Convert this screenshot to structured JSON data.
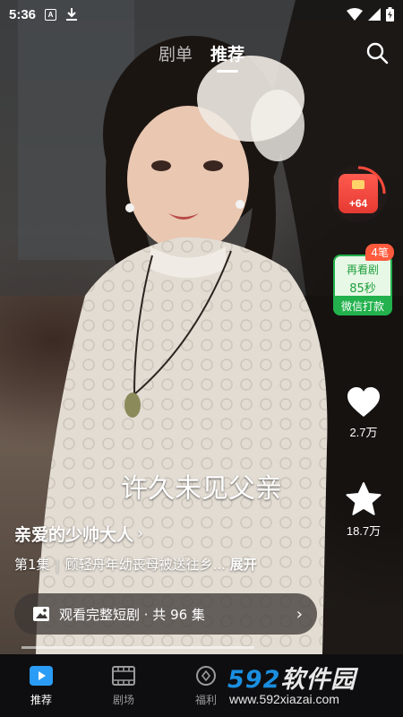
{
  "status_bar": {
    "time": "5:36",
    "app_icon_letter": "A"
  },
  "top_tabs": [
    {
      "label": "剧单",
      "active": false
    },
    {
      "label": "推荐",
      "active": true
    }
  ],
  "actions": {
    "redpacket_amount": "+64",
    "wechat_badge": "4笔",
    "wechat_line1": "再看剧",
    "wechat_line2": "85秒",
    "wechat_footer": "微信打款",
    "like_count": "2.7万",
    "favorite_count": "18.7万"
  },
  "video": {
    "subtitle": "许久未见父亲",
    "drama_title": "亲爱的少帅大人",
    "episode": "第1集",
    "synopsis": "顾轻舟年幼丧母被送往乡...",
    "expand_label": "展开",
    "watch_full": "观看完整短剧 · 共 96 集",
    "progress": 0.62
  },
  "bottom_nav": [
    {
      "label": "推荐",
      "icon": "play-icon",
      "active": true
    },
    {
      "label": "剧场",
      "icon": "film-icon",
      "active": false
    },
    {
      "label": "福利",
      "icon": "coin-icon",
      "active": false
    }
  ],
  "watermark": {
    "logo_digits": "592",
    "logo_text": "软件园",
    "url": "www.592xiazai.com"
  },
  "colors": {
    "wechat_green": "#22b14c",
    "red_packet": "#e53a31",
    "watermark_blue": "#1a8fe0"
  }
}
